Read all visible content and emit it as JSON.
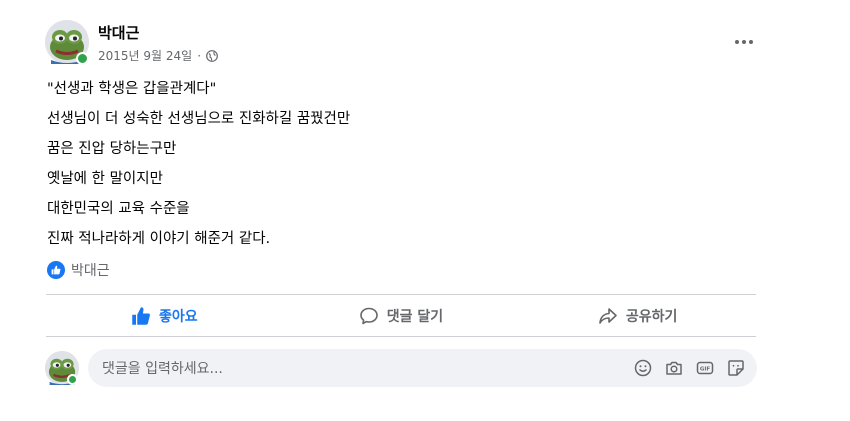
{
  "post": {
    "author": "박대근",
    "date": "2015년 9월 24일",
    "separator": "·",
    "privacy_icon": "globe-icon",
    "more_icon": "more-horizontal-icon",
    "lines": [
      "\"선생과 학생은 갑을관계다\"",
      "선생님이 더 성숙한 선생님으로 진화하길 꿈꿨건만",
      "꿈은 진압 당하는구만",
      "옛날에 한 말이지만",
      "대한민국의 교육 수준을",
      "진짜 적나라하게 이야기 해준거 같다."
    ],
    "reactions": {
      "icon": "like-reaction-icon",
      "names": "박대근"
    }
  },
  "actions": {
    "like_label": "좋아요",
    "comment_label": "댓글 달기",
    "share_label": "공유하기"
  },
  "comment_input": {
    "placeholder": "댓글을 입력하세요...",
    "tools": [
      "emoji-icon",
      "camera-icon",
      "gif-icon",
      "sticker-icon"
    ]
  },
  "colors": {
    "accent": "#1877f2",
    "secondary_text": "#65676b",
    "online": "#31a24c",
    "input_bg": "#f0f2f5"
  }
}
